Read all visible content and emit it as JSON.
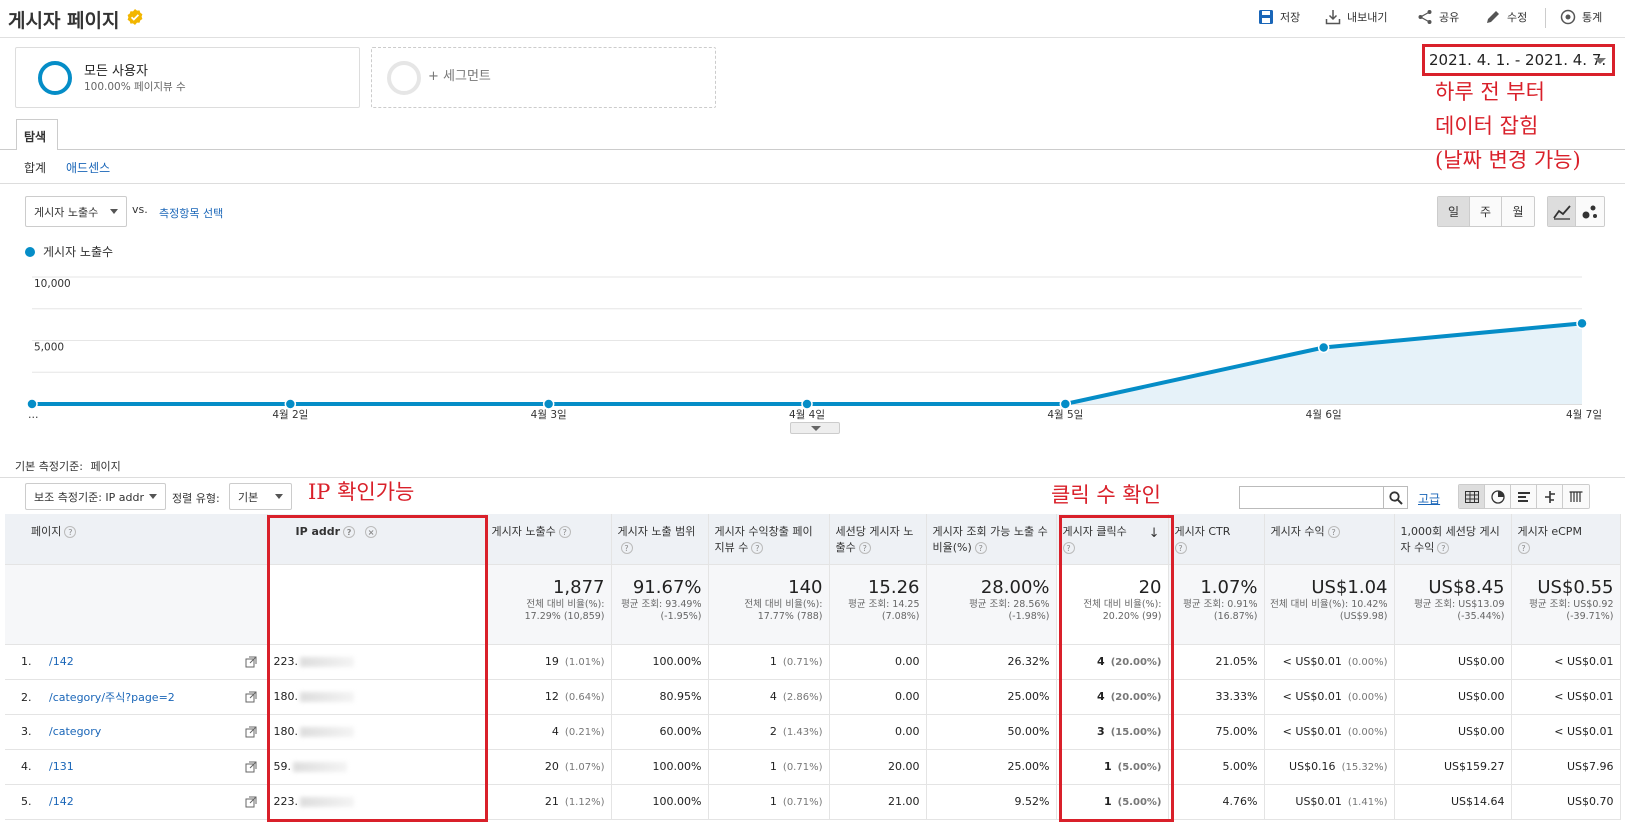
{
  "header": {
    "title": "게시자 페이지",
    "buttons": [
      {
        "label": "저장",
        "icon": "save-icon"
      },
      {
        "label": "내보내기",
        "icon": "export-icon"
      },
      {
        "label": "공유",
        "icon": "share-icon"
      },
      {
        "label": "수정",
        "icon": "edit-icon"
      },
      {
        "label": "통계",
        "icon": "insights-icon"
      }
    ]
  },
  "segments": {
    "all_users": {
      "title": "모든 사용자",
      "subtitle": "100.00% 페이지뷰 수"
    },
    "add_segment": "+ 세그먼트"
  },
  "date_range": "2021. 4. 1. - 2021. 4. 7.",
  "annotations": {
    "date_note": [
      "하루 전 부터",
      "데이터 잡힘",
      "(날짜 변경 가능)"
    ],
    "ip_note": "IP 확인가능",
    "click_note": "클릭 수 확인"
  },
  "tabs": {
    "explore": "탐색"
  },
  "subnav": {
    "total": "합계",
    "adsense": "애드센스"
  },
  "metric_selector": {
    "selected": "게시자 노출수",
    "vs": "vs.",
    "select_metric": "측정항목 선택"
  },
  "period_buttons": [
    "일",
    "주",
    "월"
  ],
  "chart_data": {
    "type": "area",
    "legend": "게시자 노출수",
    "x": [
      "…",
      "4월 2일",
      "4월 3일",
      "4월 4일",
      "4월 5일",
      "4월 6일",
      "4월 7일"
    ],
    "values": [
      0,
      0,
      0,
      0,
      0,
      4450,
      6350
    ],
    "ylim": [
      0,
      10000
    ],
    "y_ticks": [
      "10,000",
      "5,000"
    ],
    "series_color": "#058dc7"
  },
  "primary_dimension": {
    "label": "기본 측정기준:",
    "value": "페이지"
  },
  "table_controls": {
    "secondary_dim": "보조 측정기준: IP addr",
    "sort_label": "정렬 유형:",
    "sort_value": "기본",
    "advanced": "고급",
    "search_placeholder": ""
  },
  "columns": [
    "페이지",
    "IP addr",
    "게시자 노출수",
    "게시자 노출 범위",
    "게시자 수익창출 페이지뷰 수",
    "세션당 게시자 노출수",
    "게시자 조회 가능 노출 수 비율(%)",
    "게시자 클릭수",
    "게시자 CTR",
    "게시자 수익",
    "1,000회 세션당 게시자 수익",
    "게시자 eCPM"
  ],
  "totals": [
    {
      "big": "1,877",
      "small": "전체 대비 비율(%): 17.29% (10,859)"
    },
    {
      "big": "91.67%",
      "small": "평균 조회: 93.49% (-1.95%)"
    },
    {
      "big": "140",
      "small": "전체 대비 비율(%): 17.77% (788)"
    },
    {
      "big": "15.26",
      "small": "평균 조회: 14.25 (7.08%)"
    },
    {
      "big": "28.00%",
      "small": "평균 조회: 28.56% (-1.98%)"
    },
    {
      "big": "20",
      "small": "전체 대비 비율(%): 20.20% (99)"
    },
    {
      "big": "1.07%",
      "small": "평균 조회: 0.91% (16.87%)"
    },
    {
      "big": "US$1.04",
      "small": "전체 대비 비율(%): 10.42% (US$9.98)"
    },
    {
      "big": "US$8.45",
      "small": "평균 조회: US$13.09 (-35.44%)"
    },
    {
      "big": "US$0.55",
      "small": "평균 조회: US$0.92 (-39.71%)"
    }
  ],
  "rows": [
    {
      "num": "1.",
      "page": "/142",
      "ip": "223.",
      "imp": "19",
      "imp_pct": "(1.01%)",
      "cov": "100.00%",
      "mpv": "1",
      "mpv_pct": "(0.71%)",
      "ips": "0.00",
      "view": "26.32%",
      "clk": "4",
      "clk_pct": "(20.00%)",
      "ctr": "21.05%",
      "rev": "< US$0.01",
      "rev_pct": "(0.00%)",
      "rps": "US$0.00",
      "ecpm": "< US$0.01"
    },
    {
      "num": "2.",
      "page": "/category/주식?page=2",
      "ip": "180.",
      "imp": "12",
      "imp_pct": "(0.64%)",
      "cov": "80.95%",
      "mpv": "4",
      "mpv_pct": "(2.86%)",
      "ips": "0.00",
      "view": "25.00%",
      "clk": "4",
      "clk_pct": "(20.00%)",
      "ctr": "33.33%",
      "rev": "< US$0.01",
      "rev_pct": "(0.00%)",
      "rps": "US$0.00",
      "ecpm": "< US$0.01"
    },
    {
      "num": "3.",
      "page": "/category",
      "ip": "180.",
      "imp": "4",
      "imp_pct": "(0.21%)",
      "cov": "60.00%",
      "mpv": "2",
      "mpv_pct": "(1.43%)",
      "ips": "0.00",
      "view": "50.00%",
      "clk": "3",
      "clk_pct": "(15.00%)",
      "ctr": "75.00%",
      "rev": "< US$0.01",
      "rev_pct": "(0.00%)",
      "rps": "US$0.00",
      "ecpm": "< US$0.01"
    },
    {
      "num": "4.",
      "page": "/131",
      "ip": "59.",
      "imp": "20",
      "imp_pct": "(1.07%)",
      "cov": "100.00%",
      "mpv": "1",
      "mpv_pct": "(0.71%)",
      "ips": "20.00",
      "view": "25.00%",
      "clk": "1",
      "clk_pct": "(5.00%)",
      "ctr": "5.00%",
      "rev": "US$0.16",
      "rev_pct": "(15.32%)",
      "rps": "US$159.27",
      "ecpm": "US$7.96"
    },
    {
      "num": "5.",
      "page": "/142",
      "ip": "223.",
      "imp": "21",
      "imp_pct": "(1.12%)",
      "cov": "100.00%",
      "mpv": "1",
      "mpv_pct": "(0.71%)",
      "ips": "21.00",
      "view": "9.52%",
      "clk": "1",
      "clk_pct": "(5.00%)",
      "ctr": "4.76%",
      "rev": "US$0.01",
      "rev_pct": "(1.41%)",
      "rps": "US$14.64",
      "ecpm": "US$0.70"
    }
  ],
  "colors": {
    "accent": "#058dc7",
    "highlight": "#d9202a",
    "link": "#1a66b8"
  }
}
